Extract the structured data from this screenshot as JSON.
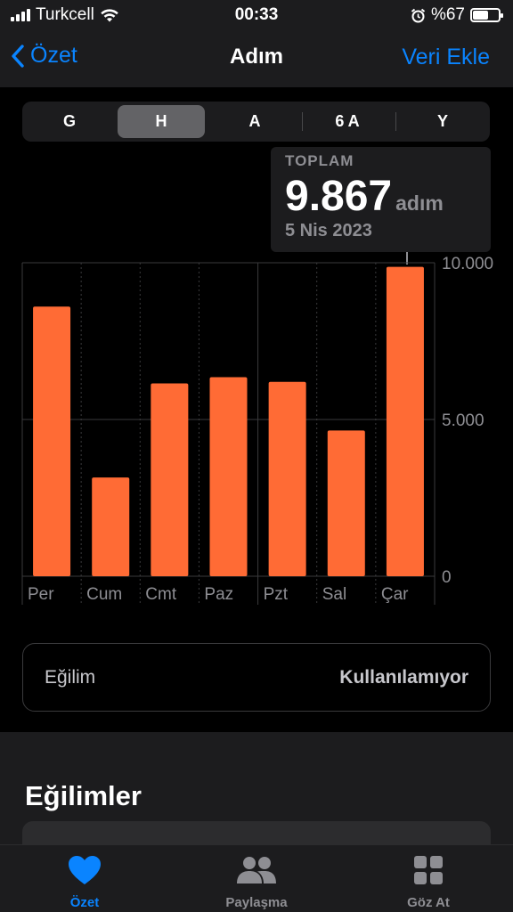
{
  "status_bar": {
    "carrier": "Turkcell",
    "time": "00:33",
    "battery": "%67",
    "battery_level": 0.67,
    "icons": [
      "signal-icon",
      "wifi-icon",
      "alarm-icon",
      "battery-icon"
    ]
  },
  "nav": {
    "back_label": "Özet",
    "title": "Adım",
    "action_label": "Veri Ekle"
  },
  "segments": {
    "items": [
      "G",
      "H",
      "A",
      "6 A",
      "Y"
    ],
    "selected": "H"
  },
  "summary": {
    "label": "TOPLAM",
    "value": "9.867",
    "unit": "adım",
    "date": "5 Nis 2023"
  },
  "chart_data": {
    "type": "bar",
    "categories": [
      "Per",
      "Cum",
      "Cmt",
      "Paz",
      "Pzt",
      "Sal",
      "Çar"
    ],
    "values": [
      8600,
      3150,
      6150,
      6350,
      6200,
      4650,
      9867
    ],
    "ylim": [
      0,
      10000
    ],
    "yticks": [
      0,
      5000,
      10000
    ],
    "ytick_labels": [
      "0",
      "5.000",
      "10.000"
    ],
    "bar_color": "#ff6b35",
    "grid": true,
    "highlighted": "Çar"
  },
  "trend": {
    "label": "Eğilim",
    "value": "Kullanılamıyor"
  },
  "section": {
    "title": "Eğilimler"
  },
  "tabbar": {
    "items": [
      {
        "label": "Özet",
        "icon": "heart-icon",
        "active": true
      },
      {
        "label": "Paylaşma",
        "icon": "people-icon",
        "active": false
      },
      {
        "label": "Göz At",
        "icon": "grid-icon",
        "active": false
      }
    ]
  },
  "colors": {
    "accent": "#0a84ff",
    "bar": "#ff6b35",
    "background": "#000000",
    "surface": "#1c1c1e"
  }
}
